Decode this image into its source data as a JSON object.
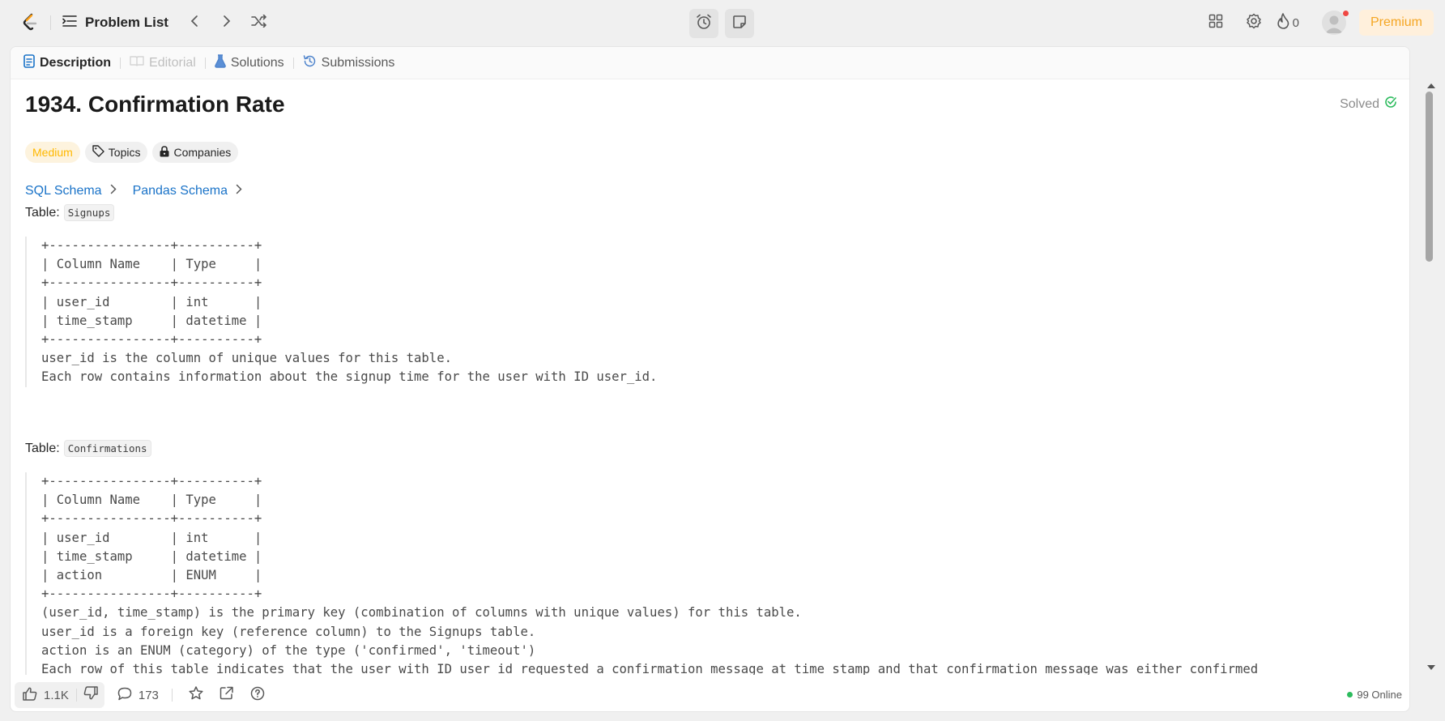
{
  "nav": {
    "problem_list_label": "Problem List",
    "streak_count": "0",
    "premium_label": "Premium"
  },
  "tabs": [
    {
      "label": "Description"
    },
    {
      "label": "Editorial"
    },
    {
      "label": "Solutions"
    },
    {
      "label": "Submissions"
    }
  ],
  "problem": {
    "title": "1934. Confirmation Rate",
    "status": "Solved",
    "difficulty": "Medium",
    "topics_label": "Topics",
    "companies_label": "Companies",
    "difficulty_color": "#ffb800"
  },
  "schema_links": {
    "sql": "SQL Schema",
    "pandas": "Pandas Schema"
  },
  "tables": [
    {
      "prefix": "Table:",
      "name": "Signups",
      "lines": [
        "+----------------+----------+",
        "| Column Name    | Type     |",
        "+----------------+----------+",
        "| user_id        | int      |",
        "| time_stamp     | datetime |",
        "+----------------+----------+",
        "user_id is the column of unique values for this table.",
        "Each row contains information about the signup time for the user with ID user_id."
      ]
    },
    {
      "prefix": "Table:",
      "name": "Confirmations",
      "lines": [
        "+----------------+----------+",
        "| Column Name    | Type     |",
        "+----------------+----------+",
        "| user_id        | int      |",
        "| time_stamp     | datetime |",
        "| action         | ENUM     |",
        "+----------------+----------+",
        "(user_id, time_stamp) is the primary key (combination of columns with unique values) for this table.",
        "user_id is a foreign key (reference column) to the Signups table.",
        "action is an ENUM (category) of the type ('confirmed', 'timeout')",
        "Each row of this table indicates that the user with ID user_id requested a confirmation message at time_stamp and that confirmation message was either confirmed"
      ]
    }
  ],
  "footer": {
    "likes": "1.1K",
    "comments": "173",
    "online": "99 Online"
  },
  "colors": {
    "accent_blue": "#1a73c8",
    "solved_green": "#2cbb5d",
    "premium_orange": "#f5a623",
    "notification_red": "#ef4743"
  },
  "icons": {
    "logo": "leetcode-logo-icon",
    "list": "list-icon",
    "prev": "chevron-left-icon",
    "next": "chevron-right-icon",
    "shuffle": "shuffle-icon",
    "timer": "alarm-clock-icon",
    "notes": "sticky-note-icon",
    "layout": "layout-grid-icon",
    "settings": "gear-icon",
    "streak": "flame-icon",
    "like": "thumbs-up-icon",
    "dislike": "thumbs-down-icon",
    "comment": "comment-icon",
    "favorite": "star-icon",
    "share": "share-icon",
    "help": "help-circle-icon"
  }
}
